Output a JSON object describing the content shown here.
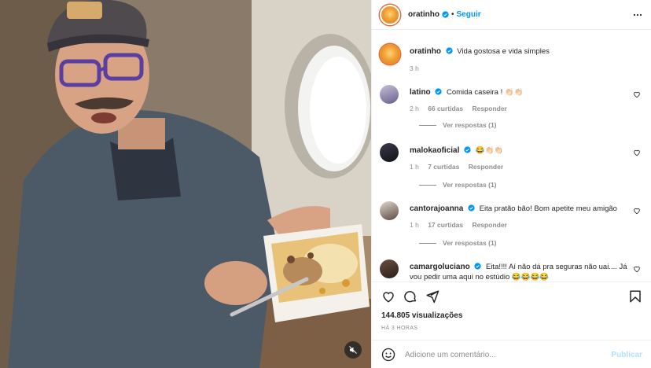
{
  "post": {
    "owner": {
      "username": "oratinho",
      "verified": true
    },
    "follow_label": "Seguir",
    "separator": "•",
    "caption": {
      "username": "oratinho",
      "text": "Vida gostosa e vida simples",
      "time": "3 h"
    },
    "comments": [
      {
        "username": "latino",
        "verified": true,
        "text": "Comida caseira ! 👏🏻👏🏻",
        "time": "2 h",
        "likes": "66 curtidas",
        "reply_label": "Responder",
        "view_replies": "Ver respostas (1)"
      },
      {
        "username": "malokaoficial",
        "verified": true,
        "text": "😂👏🏻👏🏻",
        "time": "1 h",
        "likes": "7 curtidas",
        "reply_label": "Responder",
        "view_replies": "Ver respostas (1)"
      },
      {
        "username": "cantorajoanna",
        "verified": true,
        "text": "Eita pratão bão! Bom apetite meu amigão",
        "time": "1 h",
        "likes": "17 curtidas",
        "reply_label": "Responder",
        "view_replies": "Ver respostas (1)"
      },
      {
        "username": "camargoluciano",
        "verified": true,
        "text": "Eita!!!! Aí não dá pra seguras não uai.... Já vou pedir uma aqui no estúdio 😂😂😂😂",
        "time": "",
        "likes": "",
        "reply_label": "",
        "view_replies": ""
      }
    ],
    "views": "144.805 visualizações",
    "posted_ago": "HÁ 3 HORAS",
    "add_comment_placeholder": "Adicione um comentário...",
    "publish_label": "Publicar"
  },
  "icons": {
    "verified": "verified-badge-icon",
    "more": "more-options-icon",
    "heart": "heart-icon",
    "comment": "comment-icon",
    "share": "share-icon",
    "save": "bookmark-icon",
    "emoji": "emoji-icon",
    "mute": "mute-icon"
  },
  "colors": {
    "link": "#0095f6",
    "publish_disabled": "#b2dffc",
    "muted_text": "#8e8e8e"
  }
}
